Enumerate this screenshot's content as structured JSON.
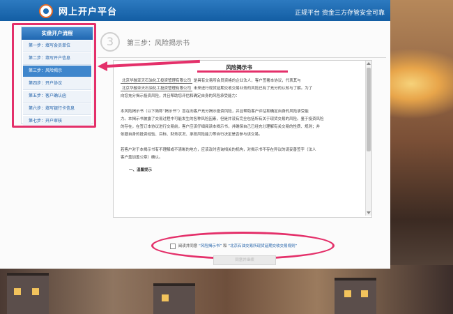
{
  "header": {
    "title": "网上开户平台",
    "slogan": "正规平台 资金三方存管安全可靠"
  },
  "sidebar": {
    "title": "实盘开户流程",
    "items": [
      {
        "label": "第一步：填写会员单位",
        "active": false
      },
      {
        "label": "第二步：填写开户信息",
        "active": false
      },
      {
        "label": "第三步：风险揭示",
        "active": true
      },
      {
        "label": "第四步：开户协议",
        "active": false
      },
      {
        "label": "第五步：客户确认函",
        "active": false
      },
      {
        "label": "第六步：填写银行卡信息",
        "active": false
      },
      {
        "label": "第七步：开户审核",
        "active": false
      }
    ]
  },
  "step": {
    "number": "3",
    "heading": "第三步：风险揭示书"
  },
  "document": {
    "title": "风险揭示书",
    "company_field_1": "北京华融亚天石油化工投资管理有限公司",
    "line1_text": "是具有交易所会员资格的企业法人，客户签署本协议，代表其与",
    "company_field_2": "北京华融亚天石油化工投资管理有限公司",
    "line2_text": "未来进行现货延期交收交易业务的风险已有了充分的认知与了解。为了",
    "line3_text": "向您充分揭示投资风险，并且帮助您评估和确定自身的风险承受能力：",
    "para2_line1": "本风险揭示书（以下简称“揭示书”）旨在向客户充分揭示投资风险，并且帮助客户评估和确定自身的风险承受能",
    "para2_line2": "力。本揭示书披露了交易过程中可能发生的各种风险因素，但是并没有完全包括所有关于现货交易的风险。鉴于投资风险",
    "para2_line3": "的存在，在签订本协议进行交易前，客户应该仔细阅读本揭示书，并确保自己已经充分理解有关交易的性质、规则；并",
    "para2_line4": "依据自身的投资经验、目标、财务状况、承担风险能力等自行决定是否参与该交易。",
    "para3_line1": "若客户对于本揭示书有不理解或不清晰的地方，应该及时咨询相关的机构，对揭示书不存在异议的请妥善签字（法人",
    "para3_line2": "客户盖加盖公章）确认。",
    "section1": "一、温馨提示"
  },
  "agreement": {
    "prefix": "阅读并同意",
    "link1": "“风险揭示书”",
    "middle": "和",
    "link2": "“北京石油交易所现货延期交收交易规则”"
  },
  "next_button": {
    "label": "同意并继续"
  },
  "colors": {
    "header_blue": "#1f67b1",
    "annotation_red": "#e4306a",
    "active_step": "#3f86cc"
  }
}
